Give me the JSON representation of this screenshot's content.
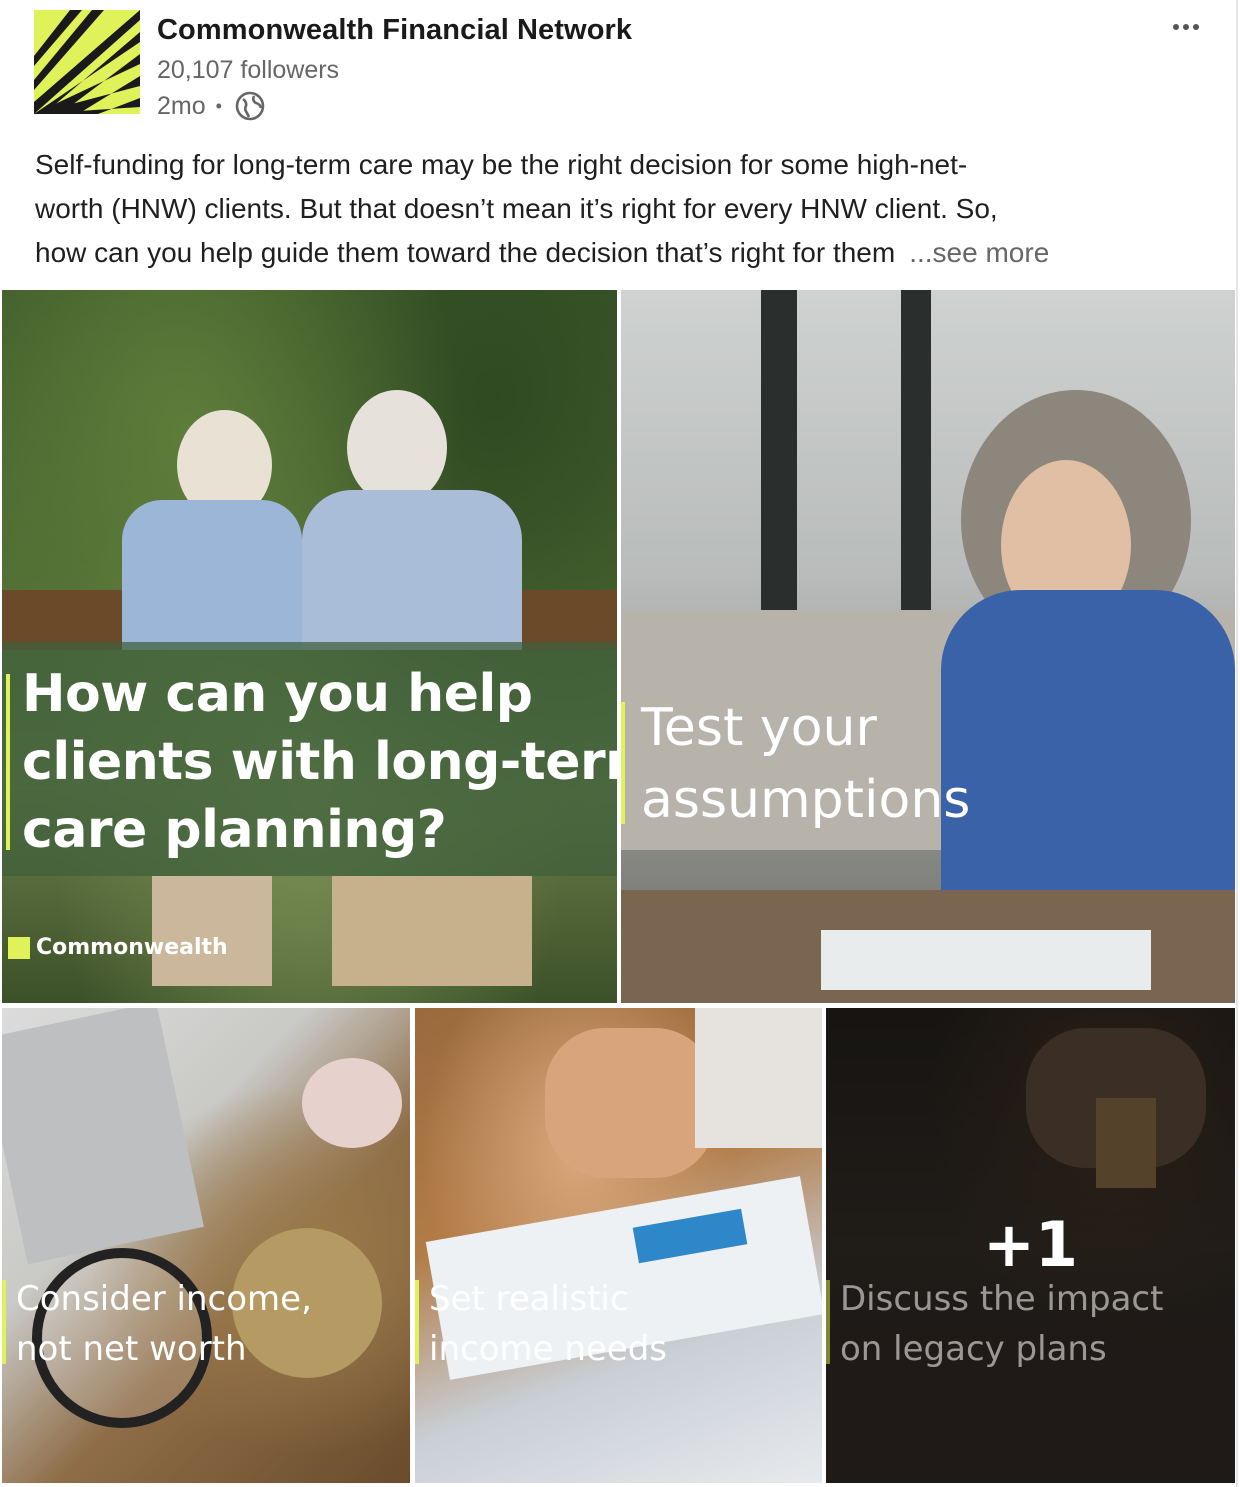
{
  "post": {
    "org_name": "Commonwealth Financial Network",
    "followers": "20,107 followers",
    "age": "2mo",
    "separator": "•",
    "visibility_icon": "globe-icon",
    "more_icon": "more-options-icon",
    "caption_lines": [
      "Self-funding for long-term care may be the right decision for some high-net-",
      "worth (HNW) clients. But that doesn’t mean it’s right for every HNW client. So,",
      "how can you help guide them toward the decision that’s right for them"
    ],
    "see_more": "...see more"
  },
  "images": {
    "tile1": {
      "lines": [
        "How can you help",
        "clients with long-term",
        "care planning?"
      ],
      "brand": "Commonwealth"
    },
    "tile2": {
      "lines": [
        "Test your",
        "assumptions"
      ]
    },
    "tile3": {
      "lines": [
        "Consider income,",
        "not net worth"
      ]
    },
    "tile4": {
      "lines": [
        "Set realistic",
        "income needs"
      ]
    },
    "tile5": {
      "lines": [
        "Discuss the impact",
        "on legacy plans"
      ],
      "more_count": "+1"
    }
  },
  "colors": {
    "brand_accent": "#dff25a",
    "overlay_green": "#3e603c",
    "muted_text": "#666666"
  }
}
